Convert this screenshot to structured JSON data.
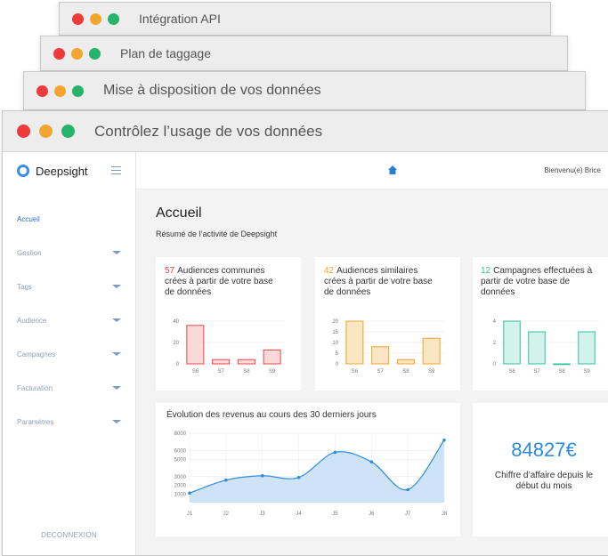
{
  "windows": [
    {
      "title": "Intégration API"
    },
    {
      "title": "Plan de taggage"
    },
    {
      "title": "Mise à disposition de vos données"
    },
    {
      "title": "Contrôlez l’usage de vos données"
    }
  ],
  "sidebar": {
    "brand": "Deepsight",
    "items": [
      {
        "label": "Accueil"
      },
      {
        "label": "Gestion"
      },
      {
        "label": "Tags"
      },
      {
        "label": "Audience"
      },
      {
        "label": "Campagnes"
      },
      {
        "label": "Facturation"
      },
      {
        "label": "Paramètres"
      }
    ],
    "logout": "DECONNEXION"
  },
  "topbar": {
    "welcome": "Bienvenu(e) Brice"
  },
  "page": {
    "title": "Accueil",
    "subtitle": "Résumé de l’activité de Deepsight"
  },
  "cards": [
    {
      "num": "57",
      "text_lines": [
        "Audiences communes",
        "crées à partir de votre base",
        "de données"
      ],
      "color": "#e8474c",
      "fill": "#fbd9d9"
    },
    {
      "num": "42",
      "text_lines": [
        "Audiences similaires",
        "crées à partir de votre base",
        "de données"
      ],
      "color": "#f0a42c",
      "fill": "#fbe6c4"
    },
    {
      "num": "12",
      "text_lines": [
        "Campagnes effectuées à",
        "partir de votre base de",
        "données"
      ],
      "color": "#2fc1a0",
      "fill": "#d3f3ea"
    }
  ],
  "revenue": {
    "title": "Évolution des revenus au cours des 30 derniers jours",
    "big_value": "84827€",
    "big_text_lines": [
      "Chiffre d’affaire depuis le",
      "début du mois"
    ]
  },
  "chart_data": [
    {
      "type": "bar",
      "categories": [
        "S6",
        "S7",
        "S8",
        "S9"
      ],
      "values": [
        36,
        4,
        4,
        13
      ],
      "ylim": [
        0,
        40
      ],
      "yticks": [
        "40",
        "20",
        "0"
      ],
      "color": "#e8474c"
    },
    {
      "type": "bar",
      "categories": [
        "S6",
        "S7",
        "S8",
        "S9"
      ],
      "values": [
        20,
        8,
        2,
        12
      ],
      "ylim": [
        0,
        20
      ],
      "yticks": [
        "20",
        "15",
        "10",
        "5",
        "0"
      ],
      "color": "#f0a42c"
    },
    {
      "type": "bar",
      "categories": [
        "S6",
        "S7",
        "S8",
        "S9"
      ],
      "values": [
        4,
        3,
        0,
        3
      ],
      "ylim": [
        0,
        4
      ],
      "yticks": [
        "4",
        "2",
        "0"
      ],
      "color": "#2fc1a0"
    },
    {
      "type": "area",
      "categories": [
        "J1",
        "J2",
        "J3",
        "J4",
        "J5",
        "J6",
        "J7",
        "J8"
      ],
      "values": [
        1100,
        2600,
        3100,
        2900,
        5800,
        4700,
        1500,
        7200
      ],
      "ylim": [
        0,
        8000
      ],
      "yticks": [
        "8000",
        "6000",
        "5000",
        "3000",
        "2000",
        "1000"
      ],
      "color": "#2a8ce0"
    }
  ]
}
